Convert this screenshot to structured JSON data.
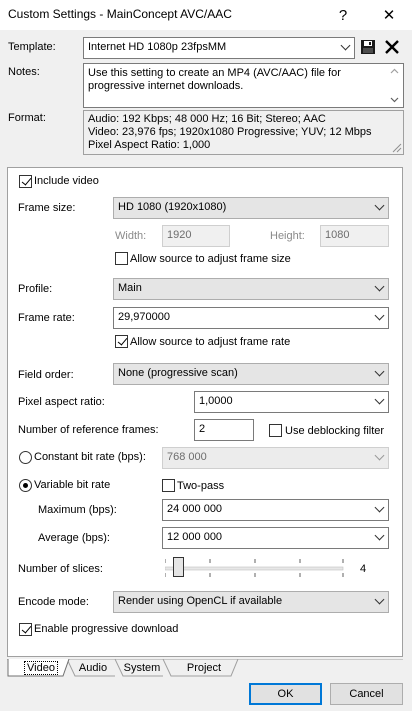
{
  "window": {
    "title": "Custom Settings - MainConcept AVC/AAC",
    "help_glyph": "?",
    "close_glyph": "✕"
  },
  "template": {
    "label": "Template:",
    "value": "Internet HD 1080p 23fpsMM",
    "save_icon": "floppy-disk-icon",
    "delete_icon": "x-delete-icon"
  },
  "notes": {
    "label": "Notes:",
    "text": "Use this setting to create an MP4 (AVC/AAC) file for progressive internet downloads."
  },
  "format": {
    "label": "Format:",
    "lines": [
      "Audio: 192 Kbps; 48 000 Hz; 16 Bit; Stereo; AAC",
      "Video: 23,976 fps; 1920x1080 Progressive; YUV; 12 Mbps",
      "Pixel Aspect Ratio: 1,000"
    ]
  },
  "video": {
    "include_video_label": "Include video",
    "include_video_checked": true,
    "frame_size_label": "Frame size:",
    "frame_size_value": "HD 1080 (1920x1080)",
    "width_label": "Width:",
    "width_value": "1920",
    "height_label": "Height:",
    "height_value": "1080",
    "allow_adjust_frame_size_label": "Allow source to adjust frame size",
    "allow_adjust_frame_size_checked": false,
    "profile_label": "Profile:",
    "profile_value": "Main",
    "frame_rate_label": "Frame rate:",
    "frame_rate_value": "29,970000",
    "allow_adjust_frame_rate_label": "Allow source to adjust frame rate",
    "allow_adjust_frame_rate_checked": true,
    "field_order_label": "Field order:",
    "field_order_value": "None (progressive scan)",
    "par_label": "Pixel aspect ratio:",
    "par_value": "1,0000",
    "ref_frames_label": "Number of reference frames:",
    "ref_frames_value": "2",
    "deblocking_label": "Use deblocking filter",
    "deblocking_checked": false,
    "cbr_label": "Constant bit rate (bps):",
    "cbr_value": "768 000",
    "vbr_label": "Variable bit rate",
    "two_pass_label": "Two-pass",
    "two_pass_checked": false,
    "maximum_label": "Maximum (bps):",
    "maximum_value": "24 000 000",
    "average_label": "Average (bps):",
    "average_value": "12 000 000",
    "slices_label": "Number of slices:",
    "slices_value": "4",
    "slices_level": 0.0,
    "encode_mode_label": "Encode mode:",
    "encode_mode_value": "Render using OpenCL if available",
    "progressive_download_label": "Enable progressive download",
    "progressive_download_checked": true
  },
  "tabs": [
    "Video",
    "Audio",
    "System",
    "Project"
  ],
  "active_tab": "Video",
  "buttons": {
    "ok": "OK",
    "cancel": "Cancel"
  },
  "colors": {
    "accent": "#0078d7",
    "save_icon": "#1a1a1a"
  }
}
